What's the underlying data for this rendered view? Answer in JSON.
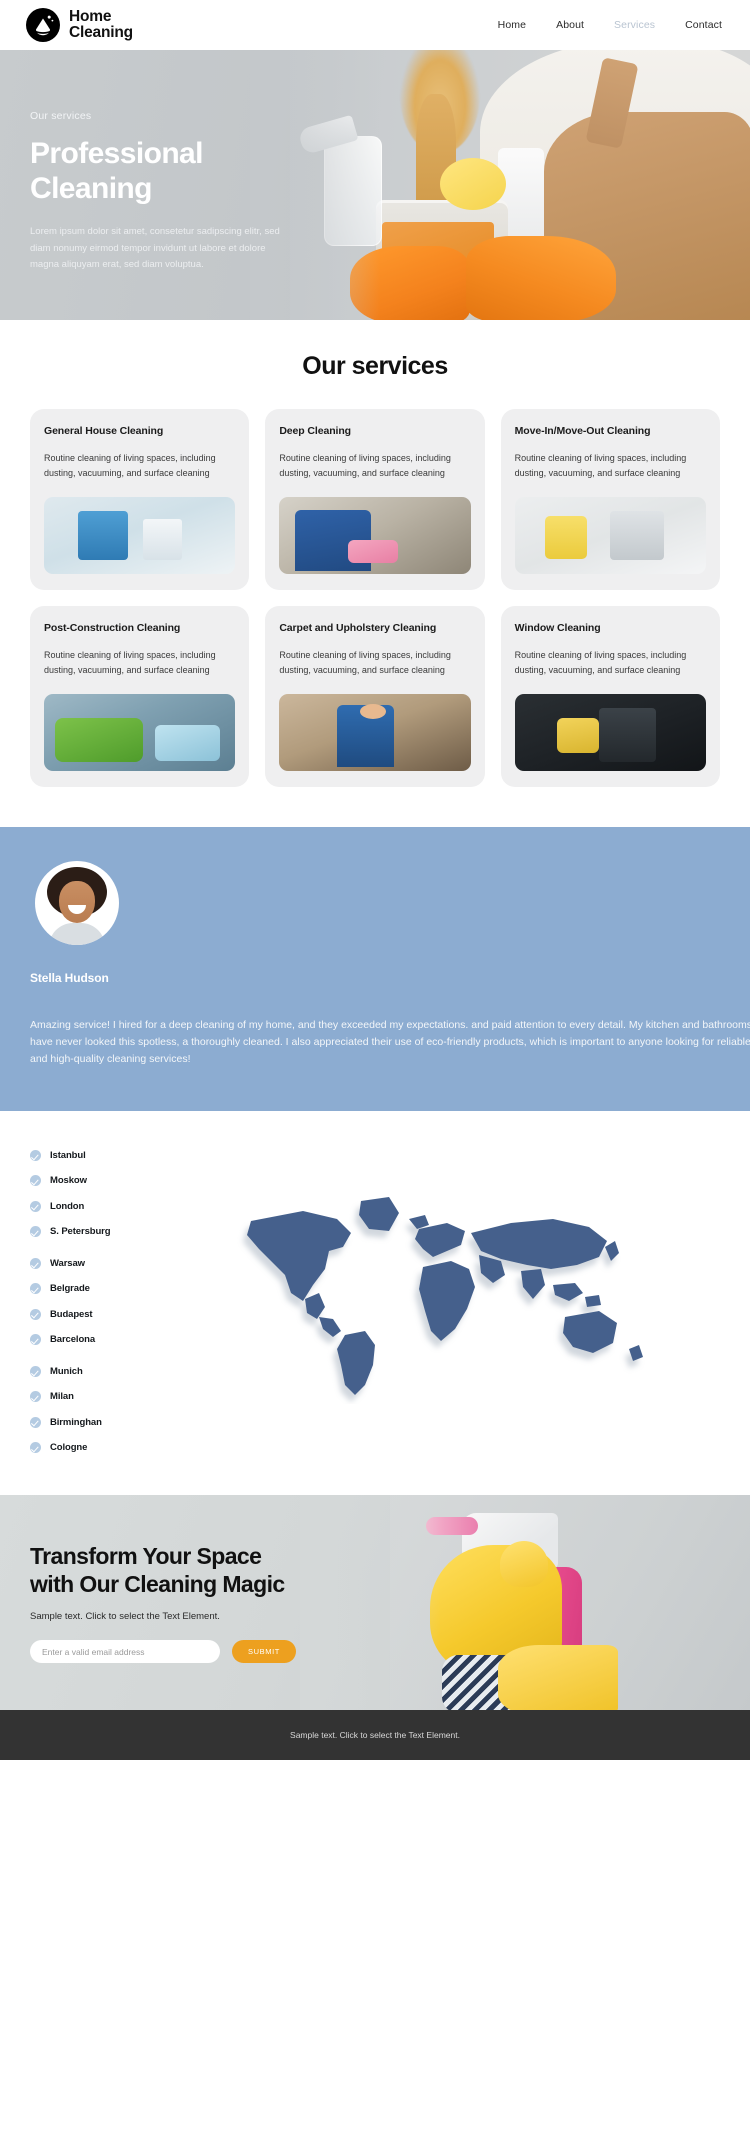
{
  "header": {
    "brand": {
      "line1": "Home",
      "line2": "Cleaning",
      "icon": "water-drop-house-icon"
    },
    "nav": [
      {
        "label": "Home",
        "active": false
      },
      {
        "label": "About",
        "active": false
      },
      {
        "label": "Services",
        "active": true
      },
      {
        "label": "Contact",
        "active": false
      }
    ]
  },
  "hero": {
    "eyebrow": "Our services",
    "title_line1": "Professional",
    "title_line2": "Cleaning",
    "copy": "Lorem ipsum dolor sit amet, consetetur sadipscing elitr, sed diam nonumy eirmod tempor invidunt ut labore et dolore magna aliquyam erat, sed diam voluptua."
  },
  "services": {
    "title": "Our services",
    "body_text": "Routine cleaning of living spaces, including dusting, vacuuming, and surface cleaning",
    "cards": [
      {
        "title": "General House Cleaning",
        "body": "Routine cleaning of living spaces, including dusting, vacuuming, and surface cleaning",
        "image": "spray-bottles-photo"
      },
      {
        "title": "Deep Cleaning",
        "body": "Routine cleaning of living spaces, including dusting, vacuuming, and surface cleaning",
        "image": "cleaner-in-blue-uniform-photo"
      },
      {
        "title": "Move-In/Move-Out Cleaning",
        "body": "Routine cleaning of living spaces, including dusting, vacuuming, and surface cleaning",
        "image": "cleaning-supplies-flatlay-photo"
      },
      {
        "title": "Post-Construction Cleaning",
        "body": "Routine cleaning of living spaces, including dusting, vacuuming, and surface cleaning",
        "image": "sofa-cushions-cleaning-photo"
      },
      {
        "title": "Carpet and Upholstery Cleaning",
        "body": "Routine cleaning of living spaces, including dusting, vacuuming, and surface cleaning",
        "image": "cleaner-with-mop-in-room-photo"
      },
      {
        "title": "Window Cleaning",
        "body": "Routine cleaning of living spaces, including dusting, vacuuming, and surface cleaning",
        "image": "window-wiping-dark-photo"
      }
    ]
  },
  "testimonial": {
    "avatar": "smiling-woman-avatar",
    "name": "Stella Hudson",
    "quote": "Amazing service! I hired for a deep cleaning of my home, and they exceeded my expectations. and paid attention to every detail. My kitchen and bathrooms have never looked this spotless, a thoroughly cleaned. I also appreciated their use of eco-friendly products, which is important to anyone looking for reliable and high-quality cleaning services!"
  },
  "locations": {
    "map": "world-map-graphic",
    "groups": [
      {
        "cities": [
          "Istanbul",
          "Moskow",
          "London",
          "S. Petersburg"
        ]
      },
      {
        "cities": [
          "Warsaw",
          "Belgrade",
          "Budapest",
          "Barcelona"
        ]
      },
      {
        "cities": [
          "Munich",
          "Milan",
          "Birminghan",
          "Cologne"
        ]
      }
    ]
  },
  "cta": {
    "title_line1": "Transform Your Space",
    "title_line2": "with Our Cleaning Magic",
    "subtitle": "Sample text. Click to select the Text Element.",
    "email_placeholder": "Enter a valid email address",
    "email_value": "",
    "submit_label": "SUBMIT"
  },
  "footer": {
    "text": "Sample text. Click to select the Text Element."
  },
  "colors": {
    "accent_orange": "#eda01f",
    "testimonial_blue": "#8cacd1",
    "map_blue": "#44618c",
    "check_blue": "#b4cbe2",
    "footer_dark": "#333333",
    "card_gray": "#efeff0",
    "nav_active": "#b9c4d1"
  }
}
